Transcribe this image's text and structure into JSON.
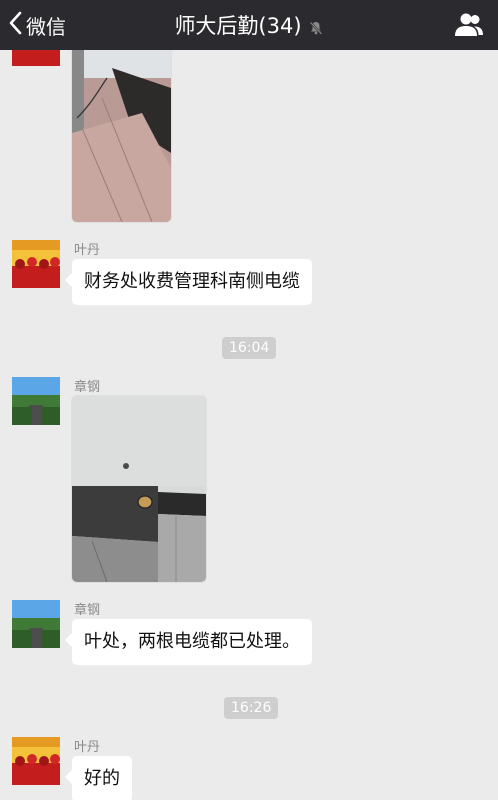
{
  "header": {
    "back_label": "微信",
    "title": "师大后勤(34)",
    "bg_color": "#2b2b2f"
  },
  "icons": {
    "back": "chevron-left-icon",
    "mute": "bell-muted-icon",
    "members": "group-members-icon"
  },
  "messages": [
    {
      "type": "image",
      "sender": "",
      "avatar": "red-group-avatar",
      "content": "photo-of-wall-and-cable"
    },
    {
      "type": "text",
      "sender": "叶丹",
      "avatar": "red-group-avatar",
      "text": "财务处收费管理科南侧电缆"
    },
    {
      "type": "time",
      "text": "16:04"
    },
    {
      "type": "image",
      "sender": "章钢",
      "avatar": "road-landscape-avatar",
      "content": "photo-of-wall-hole"
    },
    {
      "type": "text",
      "sender": "章钢",
      "avatar": "road-landscape-avatar",
      "text": "叶处，两根电缆都已处理。"
    },
    {
      "type": "time",
      "text": "16:26"
    },
    {
      "type": "text",
      "sender": "叶丹",
      "avatar": "red-group-avatar",
      "text": "好的"
    }
  ]
}
